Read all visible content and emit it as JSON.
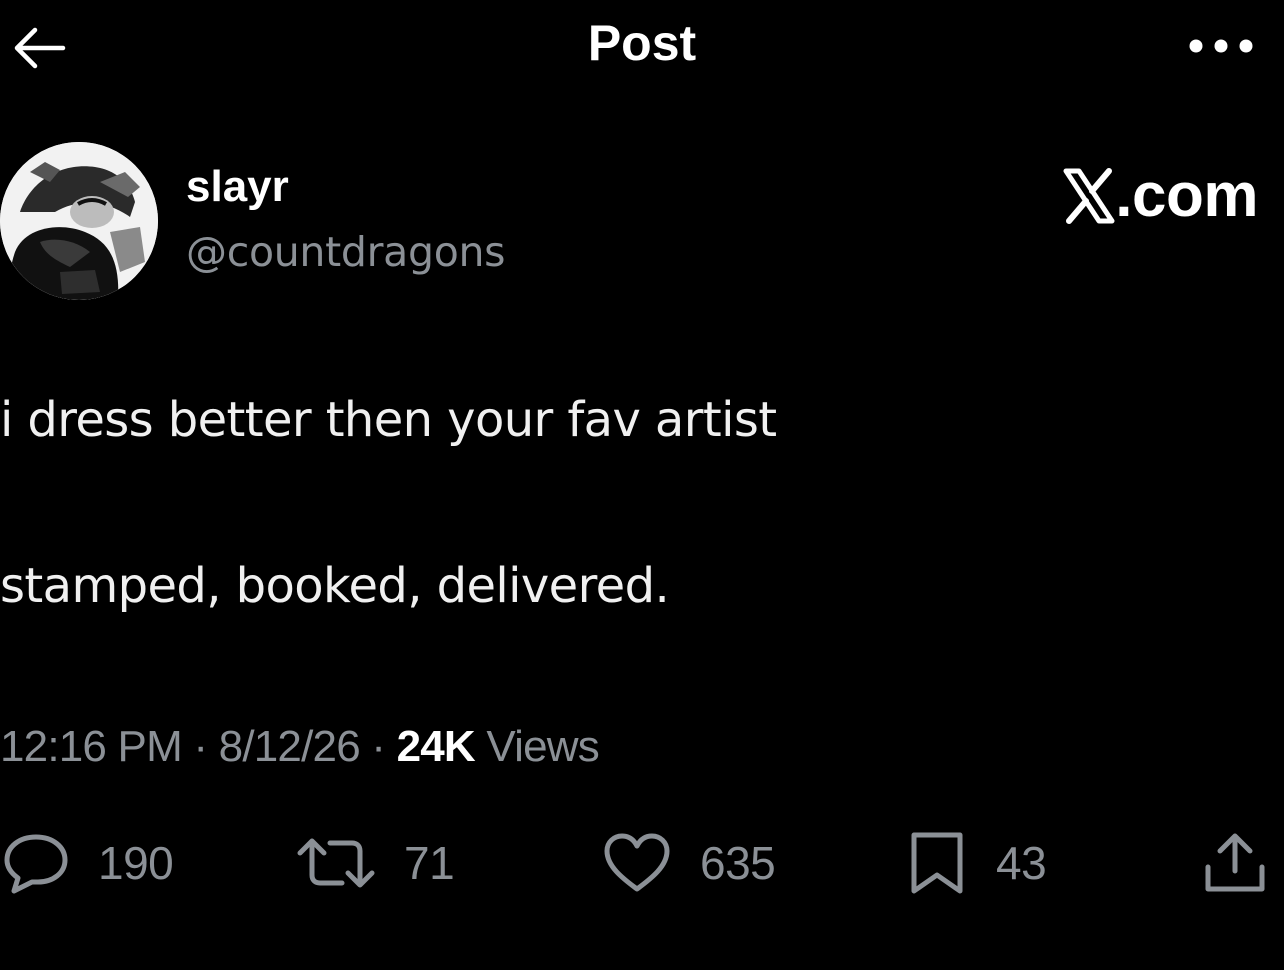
{
  "header": {
    "title": "Post",
    "back_icon": "back-arrow-icon",
    "more_icon": "more-horizontal-icon"
  },
  "author": {
    "display_name": "slayr",
    "handle": "@countdragons",
    "avatar_icon": "avatar-image"
  },
  "watermark": {
    "text": ".com",
    "logo": "x-logo-icon"
  },
  "post": {
    "lines": [
      "i dress better then your fav artist",
      "stamped, booked, delivered."
    ]
  },
  "meta": {
    "time": "12:16 PM",
    "date": "8/12/26",
    "separator": "·",
    "views_count": "24K",
    "views_label": "Views"
  },
  "actions": {
    "replies": "190",
    "reposts": "71",
    "likes": "635",
    "bookmarks": "43"
  },
  "colors": {
    "background": "#000000",
    "primary_text": "#ffffff",
    "secondary_text": "#8b9096"
  }
}
